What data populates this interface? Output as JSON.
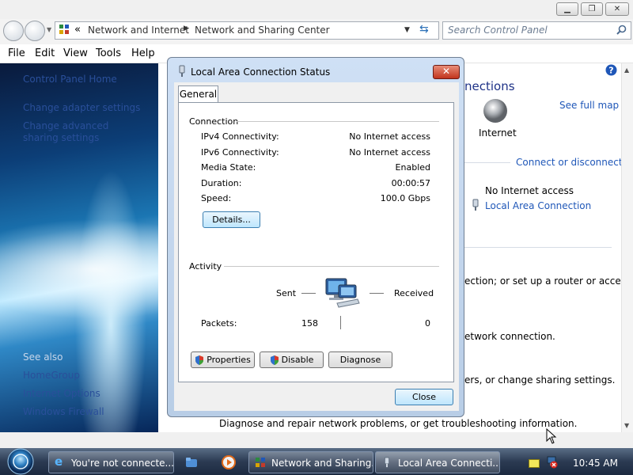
{
  "window": {
    "breadcrumb": [
      "Network and Internet",
      "Network and Sharing Center"
    ],
    "breadcrumb_prefix": "«",
    "search_placeholder": "Search Control Panel",
    "menu": [
      "File",
      "Edit",
      "View",
      "Tools",
      "Help"
    ],
    "titlebar_buttons": {
      "minimize": "▁",
      "maximize": "❐",
      "close": "✕"
    }
  },
  "left_pane": {
    "links": [
      "Control Panel Home",
      "Change adapter settings",
      "Change advanced sharing settings"
    ],
    "see_also_label": "See also",
    "see_also_items": [
      "HomeGroup",
      "Internet Options",
      "Windows Firewall"
    ]
  },
  "main": {
    "heading_fragment": "nections",
    "see_full_map": "See full map",
    "internet_label": "Internet",
    "connect_disconnect": "Connect or disconnect",
    "access_type": "No Internet access",
    "connection_link": "Local Area Connection",
    "line1": "ection; or set up a router or access",
    "line2": "etwork connection.",
    "line3": "ers, or change sharing settings.",
    "line4": "Diagnose and repair network problems, or get troubleshooting information."
  },
  "dialog": {
    "title": "Local Area Connection Status",
    "close_glyph": "✕",
    "tab": "General",
    "connection_group": "Connection",
    "rows": [
      {
        "label": "IPv4 Connectivity:",
        "value": "No Internet access"
      },
      {
        "label": "IPv6 Connectivity:",
        "value": "No Internet access"
      },
      {
        "label": "Media State:",
        "value": "Enabled"
      },
      {
        "label": "Duration:",
        "value": "00:00:57"
      },
      {
        "label": "Speed:",
        "value": "100.0 Gbps"
      }
    ],
    "details_button": "Details...",
    "activity_group": "Activity",
    "sent_label": "Sent",
    "received_label": "Received",
    "packets_label": "Packets:",
    "packets_sent": "158",
    "packets_received": "0",
    "properties_button": "Properties",
    "disable_button": "Disable",
    "diagnose_button": "Diagnose",
    "close_button": "Close"
  },
  "taskbar": {
    "items": [
      "You're not connecte...",
      "Network and Sharing...",
      "Local Area Connecti..."
    ],
    "clock": "10:45 AM"
  },
  "colors": {
    "link": "#1f57b8",
    "dialog_frame": "#b8cde6",
    "taskbar": "#2b3a52"
  }
}
